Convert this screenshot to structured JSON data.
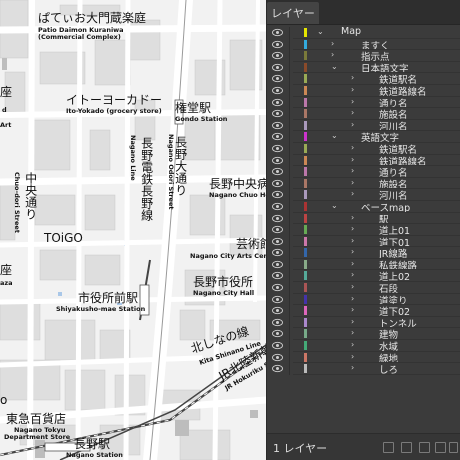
{
  "panel": {
    "tab_label": "レイヤー",
    "footer_label": "1 レイヤー",
    "rows": [
      {
        "name": "Map",
        "depth": 0,
        "kind": "open",
        "color": "#e6e600"
      },
      {
        "name": "ますく",
        "depth": 1,
        "kind": "closed",
        "color": "#3ad"
      },
      {
        "name": "指示点",
        "depth": 1,
        "kind": "closed",
        "color": "#7a7a3a"
      },
      {
        "name": "日本語文字",
        "depth": 1,
        "kind": "open",
        "color": "#8a4a2a"
      },
      {
        "name": "鉄道駅名",
        "depth": 2,
        "kind": "closed",
        "color": "#9a5"
      },
      {
        "name": "鉄道路線名",
        "depth": 2,
        "kind": "closed",
        "color": "#c85"
      },
      {
        "name": "通り名",
        "depth": 2,
        "kind": "closed",
        "color": "#b7a"
      },
      {
        "name": "施設名",
        "depth": 2,
        "kind": "closed",
        "color": "#a76"
      },
      {
        "name": "河川名",
        "depth": 2,
        "kind": "closed",
        "color": "#a9b"
      },
      {
        "name": "英語文字",
        "depth": 1,
        "kind": "open",
        "color": "#c3c"
      },
      {
        "name": "鉄道駅名",
        "depth": 2,
        "kind": "closed",
        "color": "#9a5"
      },
      {
        "name": "鉄道路線名",
        "depth": 2,
        "kind": "closed",
        "color": "#c85"
      },
      {
        "name": "通り名",
        "depth": 2,
        "kind": "closed",
        "color": "#b7a"
      },
      {
        "name": "施設名",
        "depth": 2,
        "kind": "closed",
        "color": "#a76"
      },
      {
        "name": "河川名",
        "depth": 2,
        "kind": "closed",
        "color": "#a9b"
      },
      {
        "name": "ベースmap",
        "depth": 1,
        "kind": "open",
        "color": "#a33"
      },
      {
        "name": "駅",
        "depth": 2,
        "kind": "closed",
        "color": "#b44"
      },
      {
        "name": "道上01",
        "depth": 2,
        "kind": "closed",
        "color": "#6a5"
      },
      {
        "name": "道下01",
        "depth": 2,
        "kind": "closed",
        "color": "#c7a"
      },
      {
        "name": "JR線路",
        "depth": 2,
        "kind": "closed",
        "color": "#36a"
      },
      {
        "name": "私鉄線路",
        "depth": 2,
        "kind": "closed",
        "color": "#8a8"
      },
      {
        "name": "道上02",
        "depth": 2,
        "kind": "closed",
        "color": "#5a9"
      },
      {
        "name": "石段",
        "depth": 2,
        "kind": "closed",
        "color": "#a55"
      },
      {
        "name": "道塗り",
        "depth": 2,
        "kind": "closed",
        "color": "#43a"
      },
      {
        "name": "道下02",
        "depth": 2,
        "kind": "closed",
        "color": "#d6b"
      },
      {
        "name": "トンネル",
        "depth": 2,
        "kind": "closed",
        "color": "#a8c"
      },
      {
        "name": "建物",
        "depth": 2,
        "kind": "closed",
        "color": "#7a8"
      },
      {
        "name": "水域",
        "depth": 2,
        "kind": "closed",
        "color": "#4a7"
      },
      {
        "name": "緑地",
        "depth": 2,
        "kind": "closed",
        "color": "#c76"
      },
      {
        "name": "しろ",
        "depth": 2,
        "kind": "closed",
        "color": "#bbb"
      }
    ]
  },
  "map_labels": {
    "patio_jp": "ぱてぃお大門蔵楽庭",
    "patio_en1": "Patio Daimon Kuraniwa",
    "patio_en2": "(Commercial Complex)",
    "itoyokado_jp": "イトーヨーカドー",
    "itoyokado_en": "Ito-Yokado (grocery store)",
    "gondo_jp": "権堂駅",
    "gondo_en": "Gondo Station",
    "nagano_line_jp": "長野電鉄長野線",
    "nagano_line_en": "Nagano Line",
    "odori_jp": "長野大通り",
    "odori_en": "Nagano Odori Street",
    "chuo_jp": "中央通り",
    "chuo_en": "Chuo-dori Street",
    "chuo_hospital_jp": "長野中央病",
    "chuo_hospital_en": "Nagano Chuo Hosp",
    "toigo": "TOiGO",
    "arts_jp": "芸術館",
    "arts_en": "Nagano City Arts Cente",
    "city_hall_jp": "長野市役所",
    "city_hall_en": "Nagano City Hall",
    "shiyakusho_jp": "市役所前駅",
    "shiyakusho_en": "Shiyakusho-mae Station",
    "kita_jp": "北しなの線",
    "kita_en": "Kita Shinano Line",
    "jr_jp": "JR北陸新幹",
    "jr_en": "JR Hokuriku Sh",
    "tokyu_jp": "東急百貨店",
    "tokyu_en1": "Nagano Tokyu",
    "tokyu_en2": "Department Store",
    "nagano_sta_jp": "長野駅",
    "nagano_sta_en": "Nagano Station",
    "left_za1": "座",
    "left_art": "Art",
    "left_za2": "座",
    "left_aza": "aza",
    "left_d": "d",
    "left_o": "o"
  }
}
